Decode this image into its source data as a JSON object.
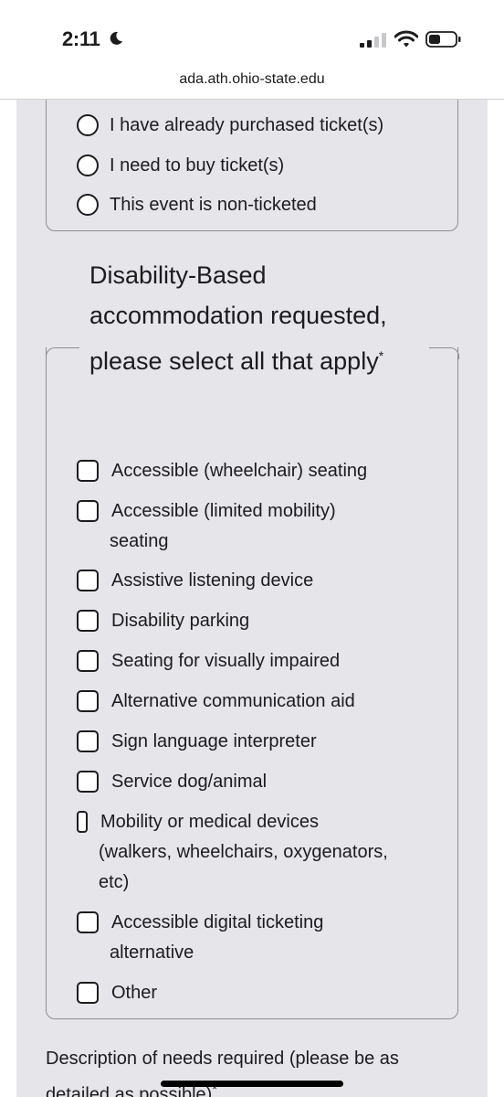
{
  "status_bar": {
    "time": "2:11"
  },
  "browser": {
    "url": "ada.ath.ohio-state.edu"
  },
  "ticket_options": [
    {
      "label": "I have already purchased ticket(s)"
    },
    {
      "label": "I need to buy ticket(s)"
    },
    {
      "label": "This event is non-ticketed"
    }
  ],
  "accommodation": {
    "legend": "Disability-Based accommodation requested, please select all that apply",
    "required_mark": "*",
    "options": [
      {
        "label": "Accessible (wheelchair) seating"
      },
      {
        "label": "Accessible (limited mobility)",
        "label_line2": "seating"
      },
      {
        "label": "Assistive listening device"
      },
      {
        "label": "Disability parking"
      },
      {
        "label": "Seating for visually impaired"
      },
      {
        "label": "Alternative communication aid"
      },
      {
        "label": "Sign language interpreter"
      },
      {
        "label": "Service dog/animal"
      },
      {
        "label": "Mobility or medical devices",
        "label_line2": "(walkers, wheelchairs, oxygenators,",
        "label_line3": "etc)"
      },
      {
        "label": "Accessible digital ticketing",
        "label_line2": "alternative"
      },
      {
        "label": "Other"
      }
    ]
  },
  "description": {
    "label": "Description of needs required (please be as detailed as possible)",
    "required_mark": "*"
  }
}
